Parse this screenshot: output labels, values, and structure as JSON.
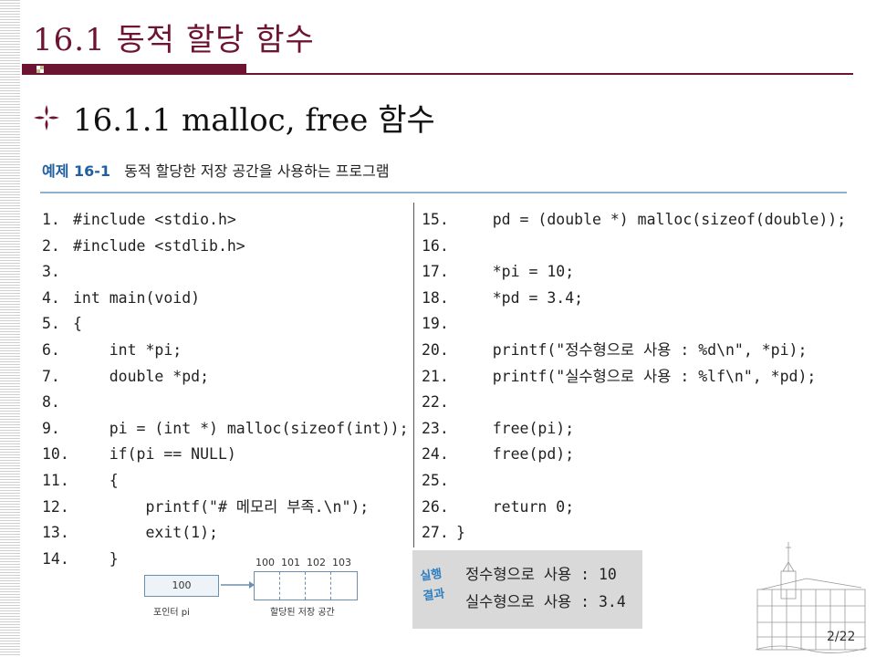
{
  "slide": {
    "title": "16.1 동적 할당 함수",
    "subtitle": "16.1.1 malloc, free 함수",
    "page_number": "2/22"
  },
  "example": {
    "tag": "예제 16-1",
    "caption": "동적 할당한 저장 공간을 사용하는 프로그램"
  },
  "code_left": [
    {
      "n": "1.",
      "t": "#include <stdio.h>"
    },
    {
      "n": "2.",
      "t": "#include <stdlib.h>"
    },
    {
      "n": "3.",
      "t": ""
    },
    {
      "n": "4.",
      "t": "int main(void)"
    },
    {
      "n": "5.",
      "t": "{"
    },
    {
      "n": "6.",
      "t": "    int *pi;"
    },
    {
      "n": "7.",
      "t": "    double *pd;"
    },
    {
      "n": "8.",
      "t": ""
    },
    {
      "n": "9.",
      "t": "    pi = (int *) malloc(sizeof(int));"
    },
    {
      "n": "10.",
      "t": "    if(pi == NULL)"
    },
    {
      "n": "11.",
      "t": "    {"
    },
    {
      "n": "12.",
      "t": "        printf(\"# 메모리 부족.\\n\");"
    },
    {
      "n": "13.",
      "t": "        exit(1);"
    },
    {
      "n": "14.",
      "t": "    }"
    }
  ],
  "code_right": [
    {
      "n": "15.",
      "t": "    pd = (double *) malloc(sizeof(double));"
    },
    {
      "n": "16.",
      "t": ""
    },
    {
      "n": "17.",
      "t": "    *pi = 10;"
    },
    {
      "n": "18.",
      "t": "    *pd = 3.4;"
    },
    {
      "n": "19.",
      "t": ""
    },
    {
      "n": "20.",
      "t": "    printf(\"정수형으로 사용 : %d\\n\", *pi);"
    },
    {
      "n": "21.",
      "t": "    printf(\"실수형으로 사용 : %lf\\n\", *pd);"
    },
    {
      "n": "22.",
      "t": ""
    },
    {
      "n": "23.",
      "t": "    free(pi);"
    },
    {
      "n": "24.",
      "t": "    free(pd);"
    },
    {
      "n": "25.",
      "t": ""
    },
    {
      "n": "26.",
      "t": "    return 0;"
    },
    {
      "n": "27.",
      "t": "}"
    }
  ],
  "diagram": {
    "pointer_value": "100",
    "pointer_label": "포인터 pi",
    "addresses": [
      "100",
      "101",
      "102",
      "103"
    ],
    "memory_label": "할당된 저장 공간"
  },
  "result": {
    "badge_line1": "실행",
    "badge_line2": "결과",
    "lines": [
      "정수형으로 사용 : 10",
      "실수형으로 사용 : 3.4"
    ]
  },
  "colors": {
    "accent": "#6d1432",
    "example_tag": "#1f5fa0",
    "rule": "#8fb3cf",
    "result_bg": "#d9d9d9",
    "badge": "#2f7fc0"
  }
}
